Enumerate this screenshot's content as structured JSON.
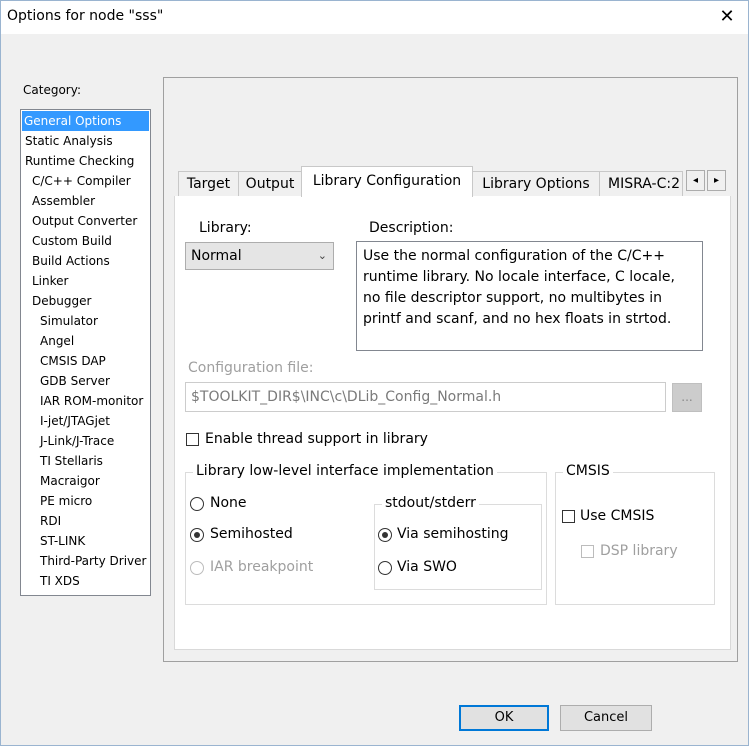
{
  "window": {
    "title": "Options for node \"sss\"",
    "close_glyph": "✕"
  },
  "category": {
    "label": "Category:",
    "items": [
      {
        "label": "General Options",
        "level": 0
      },
      {
        "label": "Static Analysis",
        "level": 0
      },
      {
        "label": "Runtime Checking",
        "level": 0
      },
      {
        "label": "C/C++ Compiler",
        "level": 1
      },
      {
        "label": "Assembler",
        "level": 1
      },
      {
        "label": "Output Converter",
        "level": 1
      },
      {
        "label": "Custom Build",
        "level": 1
      },
      {
        "label": "Build Actions",
        "level": 1
      },
      {
        "label": "Linker",
        "level": 1
      },
      {
        "label": "Debugger",
        "level": 1
      },
      {
        "label": "Simulator",
        "level": 2
      },
      {
        "label": "Angel",
        "level": 2
      },
      {
        "label": "CMSIS DAP",
        "level": 2
      },
      {
        "label": "GDB Server",
        "level": 2
      },
      {
        "label": "IAR ROM-monitor",
        "level": 2
      },
      {
        "label": "I-jet/JTAGjet",
        "level": 2
      },
      {
        "label": "J-Link/J-Trace",
        "level": 2
      },
      {
        "label": "TI Stellaris",
        "level": 2
      },
      {
        "label": "Macraigor",
        "level": 2
      },
      {
        "label": "PE micro",
        "level": 2
      },
      {
        "label": "RDI",
        "level": 2
      },
      {
        "label": "ST-LINK",
        "level": 2
      },
      {
        "label": "Third-Party Driver",
        "level": 2
      },
      {
        "label": "TI XDS",
        "level": 2
      }
    ],
    "selected": "General Options"
  },
  "tabs": [
    "Target",
    "Output",
    "Library Configuration",
    "Library Options",
    "MISRA-C:2"
  ],
  "active_tab": "Library Configuration",
  "tab_scroll": {
    "left": "◂",
    "right": "▸"
  },
  "library": {
    "label": "Library:",
    "value": "Normal",
    "dropdown_glyph": "⌄"
  },
  "description": {
    "label": "Description:",
    "text": "Use the normal configuration of the C/C++ runtime library. No locale interface, C locale, no file descriptor support, no multibytes in printf and scanf, and no hex floats in strtod."
  },
  "config_file": {
    "label": "Configuration file:",
    "value": "$TOOLKIT_DIR$\\INC\\c\\DLib_Config_Normal.h",
    "browse_label": "..."
  },
  "thread_support": {
    "label": "Enable thread support in library",
    "checked": false
  },
  "lowlevel": {
    "title": "Library low-level interface implementation",
    "options": [
      {
        "label": "None",
        "selected": false,
        "enabled": true
      },
      {
        "label": "Semihosted",
        "selected": true,
        "enabled": true
      },
      {
        "label": "IAR breakpoint",
        "selected": false,
        "enabled": false
      }
    ]
  },
  "stdout": {
    "title": "stdout/stderr",
    "options": [
      {
        "label": "Via semihosting",
        "selected": true
      },
      {
        "label": "Via SWO",
        "selected": false
      }
    ]
  },
  "cmsis": {
    "title": "CMSIS",
    "use_cmsis": {
      "label": "Use CMSIS",
      "checked": false
    },
    "dsp_library": {
      "label": "DSP library",
      "checked": false,
      "enabled": false
    }
  },
  "buttons": {
    "ok": "OK",
    "cancel": "Cancel"
  }
}
